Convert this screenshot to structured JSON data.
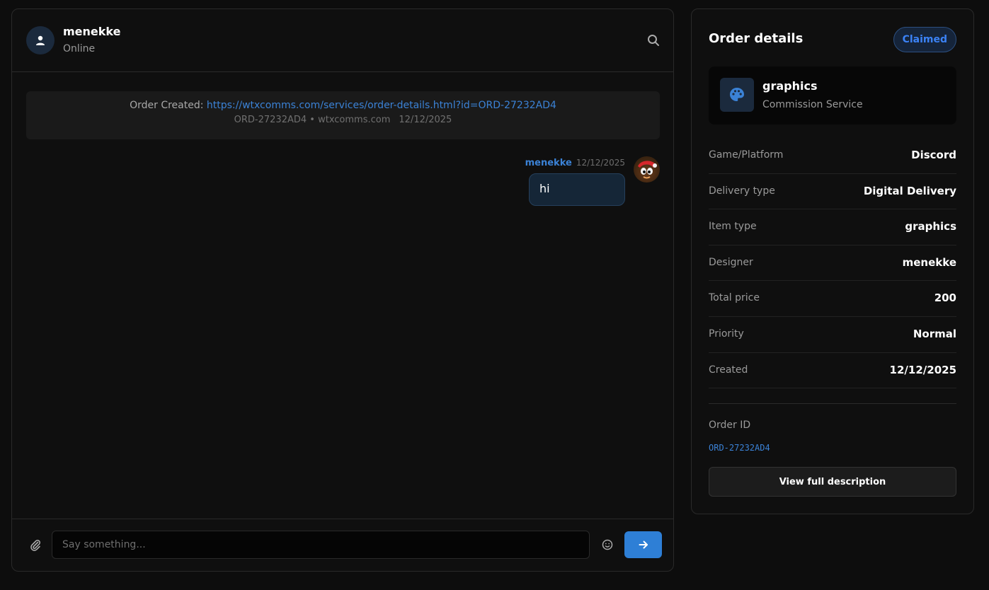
{
  "chat": {
    "header": {
      "name": "menekke",
      "status": "Online"
    },
    "order_notice": {
      "prefix": "Order Created: ",
      "link_text": "https://wtxcomms.com/services/order-details.html?id=ORD-27232AD4",
      "meta": "ORD-27232AD4 • wtxcomms.com",
      "date": "12/12/2025"
    },
    "messages": [
      {
        "author": "menekke",
        "time": "12/12/2025",
        "text": "hi"
      }
    ],
    "composer": {
      "placeholder": "Say something..."
    }
  },
  "panel": {
    "title": "Order details",
    "status_badge": "Claimed",
    "service": {
      "name": "graphics",
      "type": "Commission Service"
    },
    "rows": [
      {
        "label": "Game/Platform",
        "value": "Discord"
      },
      {
        "label": "Delivery type",
        "value": "Digital Delivery"
      },
      {
        "label": "Item type",
        "value": "graphics"
      },
      {
        "label": "Designer",
        "value": "menekke"
      },
      {
        "label": "Total price",
        "value": "200"
      },
      {
        "label": "Priority",
        "value": "Normal"
      },
      {
        "label": "Created",
        "value": "12/12/2025"
      }
    ],
    "order_id_label": "Order ID",
    "order_id": "ORD-27232AD4",
    "view_button": "View full description"
  },
  "colors": {
    "accent": "#3b82d6",
    "send_button": "#2e7fd6",
    "background": "#0d0d0d"
  },
  "icons": [
    "user-icon",
    "search-icon",
    "paperclip-icon",
    "emoji-icon",
    "arrow-right-icon",
    "palette-icon"
  ]
}
